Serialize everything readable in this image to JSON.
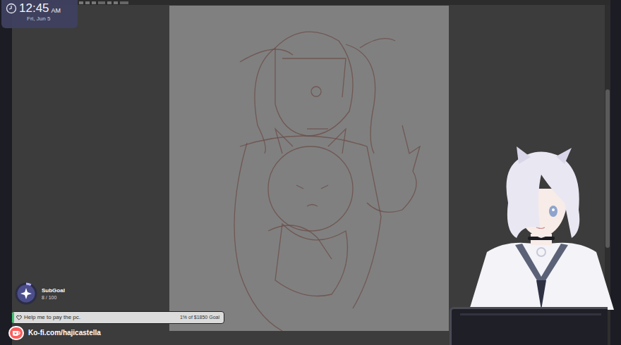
{
  "clock": {
    "time": "12:45",
    "period": "AM",
    "date": "Fri, Jun 5"
  },
  "subgoal": {
    "title": "SubGoal",
    "count": "8 / 100",
    "level": 0.08
  },
  "goal": {
    "label": "Help me to pay the pc.",
    "reading": "1% of $1850 Goal",
    "level": 0.01
  },
  "kofi": {
    "link": "Ko-fi.com/hajicastella"
  }
}
